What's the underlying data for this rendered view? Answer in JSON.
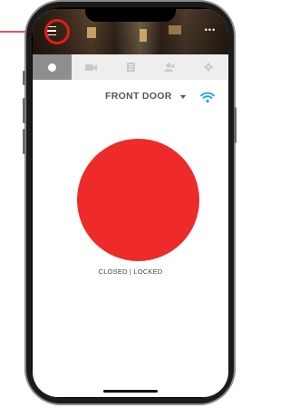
{
  "device": {
    "name": "FRONT DOOR",
    "status": "CLOSED | LOCKED",
    "status_color": "#ee2a2b",
    "connection_icon": "wifi-icon",
    "accent_color": "#1aa3d9"
  },
  "header": {
    "menu_icon": "hamburger-menu-icon",
    "more_icon": "more-dots-icon",
    "more_label": "•••"
  },
  "tabs": [
    {
      "icon": "status-dot-icon",
      "active": true
    },
    {
      "icon": "video-camera-icon",
      "active": false
    },
    {
      "icon": "event-log-icon",
      "active": false
    },
    {
      "icon": "users-icon",
      "active": false
    },
    {
      "icon": "settings-gear-icon",
      "active": false
    }
  ],
  "annotation": {
    "color": "#e21b1b",
    "target": "hamburger-menu-icon"
  }
}
